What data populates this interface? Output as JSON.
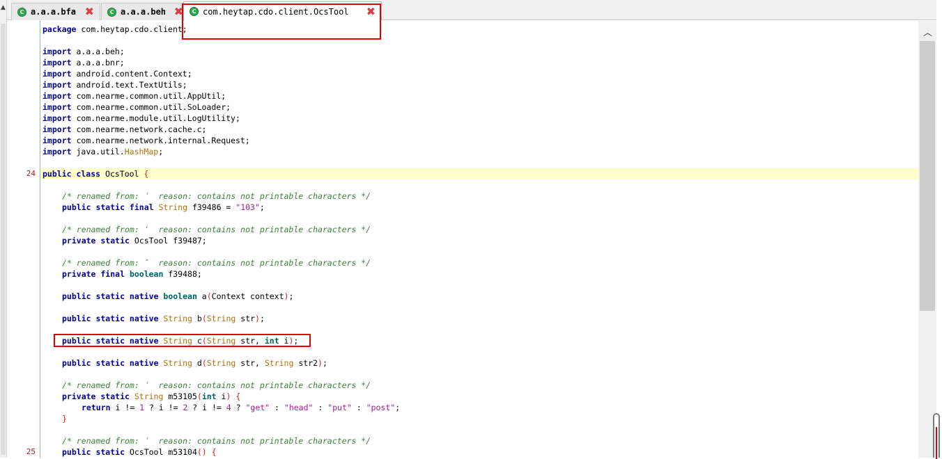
{
  "tabs": [
    {
      "label": "a.a.a.bfa",
      "icon": "class-icon",
      "active": false
    },
    {
      "label": "a.a.a.beh",
      "icon": "class-icon",
      "active": false
    },
    {
      "label": "com.heytap.cdo.client.OcsTool",
      "icon": "class-icon",
      "active": true
    }
  ],
  "gutter": {
    "line_24": "24",
    "line_25": "25"
  },
  "code": {
    "package": {
      "kw": "package",
      "name": " com.heytap.cdo.client;"
    },
    "imports": {
      "kw": "import",
      "items": [
        "a.a.a.beh;",
        "a.a.a.bnr;",
        "android.content.Context;",
        "android.text.TextUtils;",
        "com.nearme.common.util.AppUtil;",
        "com.nearme.common.util.SoLoader;",
        "com.nearme.module.util.LogUtility;",
        "com.nearme.network.cache.c;",
        "com.nearme.network.internal.Request;"
      ],
      "last_prefix": "java.util.",
      "last_type": "HashMap",
      "semi": ";"
    },
    "class_decl": {
      "mods": "public class",
      "name": " OcsTool ",
      "brace": "{"
    },
    "comment_renamed_1": "/* renamed from: ʾ  reason: contains not printable characters */",
    "comment_renamed_2": "/* renamed from: ʿ  reason: contains not printable characters */",
    "comment_renamed_3": "/* renamed from: ˆ  reason: contains not printable characters */",
    "comment_renamed_4": "/* renamed from: ʾ  reason: contains not printable characters */",
    "comment_renamed_5": "/* renamed from: ʾ  reason: contains not printable characters */",
    "field1": {
      "mods": "public static final",
      "type": " String",
      "rest": " f39486 = ",
      "value": "\"103\"",
      "end": ";"
    },
    "field2": {
      "mods": "private static",
      "rest": " OcsTool f39487;"
    },
    "field3": {
      "mods": "private final",
      "type": " boolean",
      "rest": " f39488;"
    },
    "method_a": {
      "mods": "public static native",
      "type": " boolean",
      "name": " a",
      "open": "(",
      "params": "Context context",
      "close": ")",
      "end": ";"
    },
    "method_b": {
      "mods": "public static native",
      "type": " String",
      "name": " b",
      "open": "(",
      "ptype": "String",
      "params": " str",
      "close": ")",
      "end": ";"
    },
    "method_c": {
      "mods": "public static native",
      "type": " String",
      "name": " c",
      "open": "(",
      "ptype": "String",
      "params": " str, ",
      "ptype2": "int",
      "params2": " i",
      "close": ")",
      "end": ";"
    },
    "method_d": {
      "mods": "public static native",
      "type": " String",
      "name": " d",
      "open": "(",
      "ptype": "String",
      "params": " str, ",
      "ptype2": "String",
      "params2": " str2",
      "close": ")",
      "end": ";"
    },
    "method_m53105": {
      "mods": "private static",
      "type": " String",
      "name": " m53105",
      "open": "(",
      "ptype": "int",
      "params": " i",
      "close": ")",
      "brace": " {"
    },
    "return_stmt": {
      "kw": "return",
      "p1": " i != ",
      "n1": "1",
      "p2": " ? i != ",
      "n2": "2",
      "p3": " ? i != ",
      "n3": "4",
      "p4": " ? ",
      "s1": "\"get\"",
      "p5": " : ",
      "s2": "\"head\"",
      "p6": " : ",
      "s3": "\"put\"",
      "p7": " : ",
      "s4": "\"post\"",
      "end": ";"
    },
    "close_brace": "}",
    "method_m53104": {
      "mods": "public static",
      "rest": " OcsTool m53104",
      "paren": "()",
      "brace": " {"
    }
  },
  "colors": {
    "keyword": "#00007f",
    "comment": "#3f7f3f",
    "type": "#b07010",
    "string": "#a0208f",
    "highlight": "#ffffcc",
    "annotation_box": "#e00000"
  }
}
